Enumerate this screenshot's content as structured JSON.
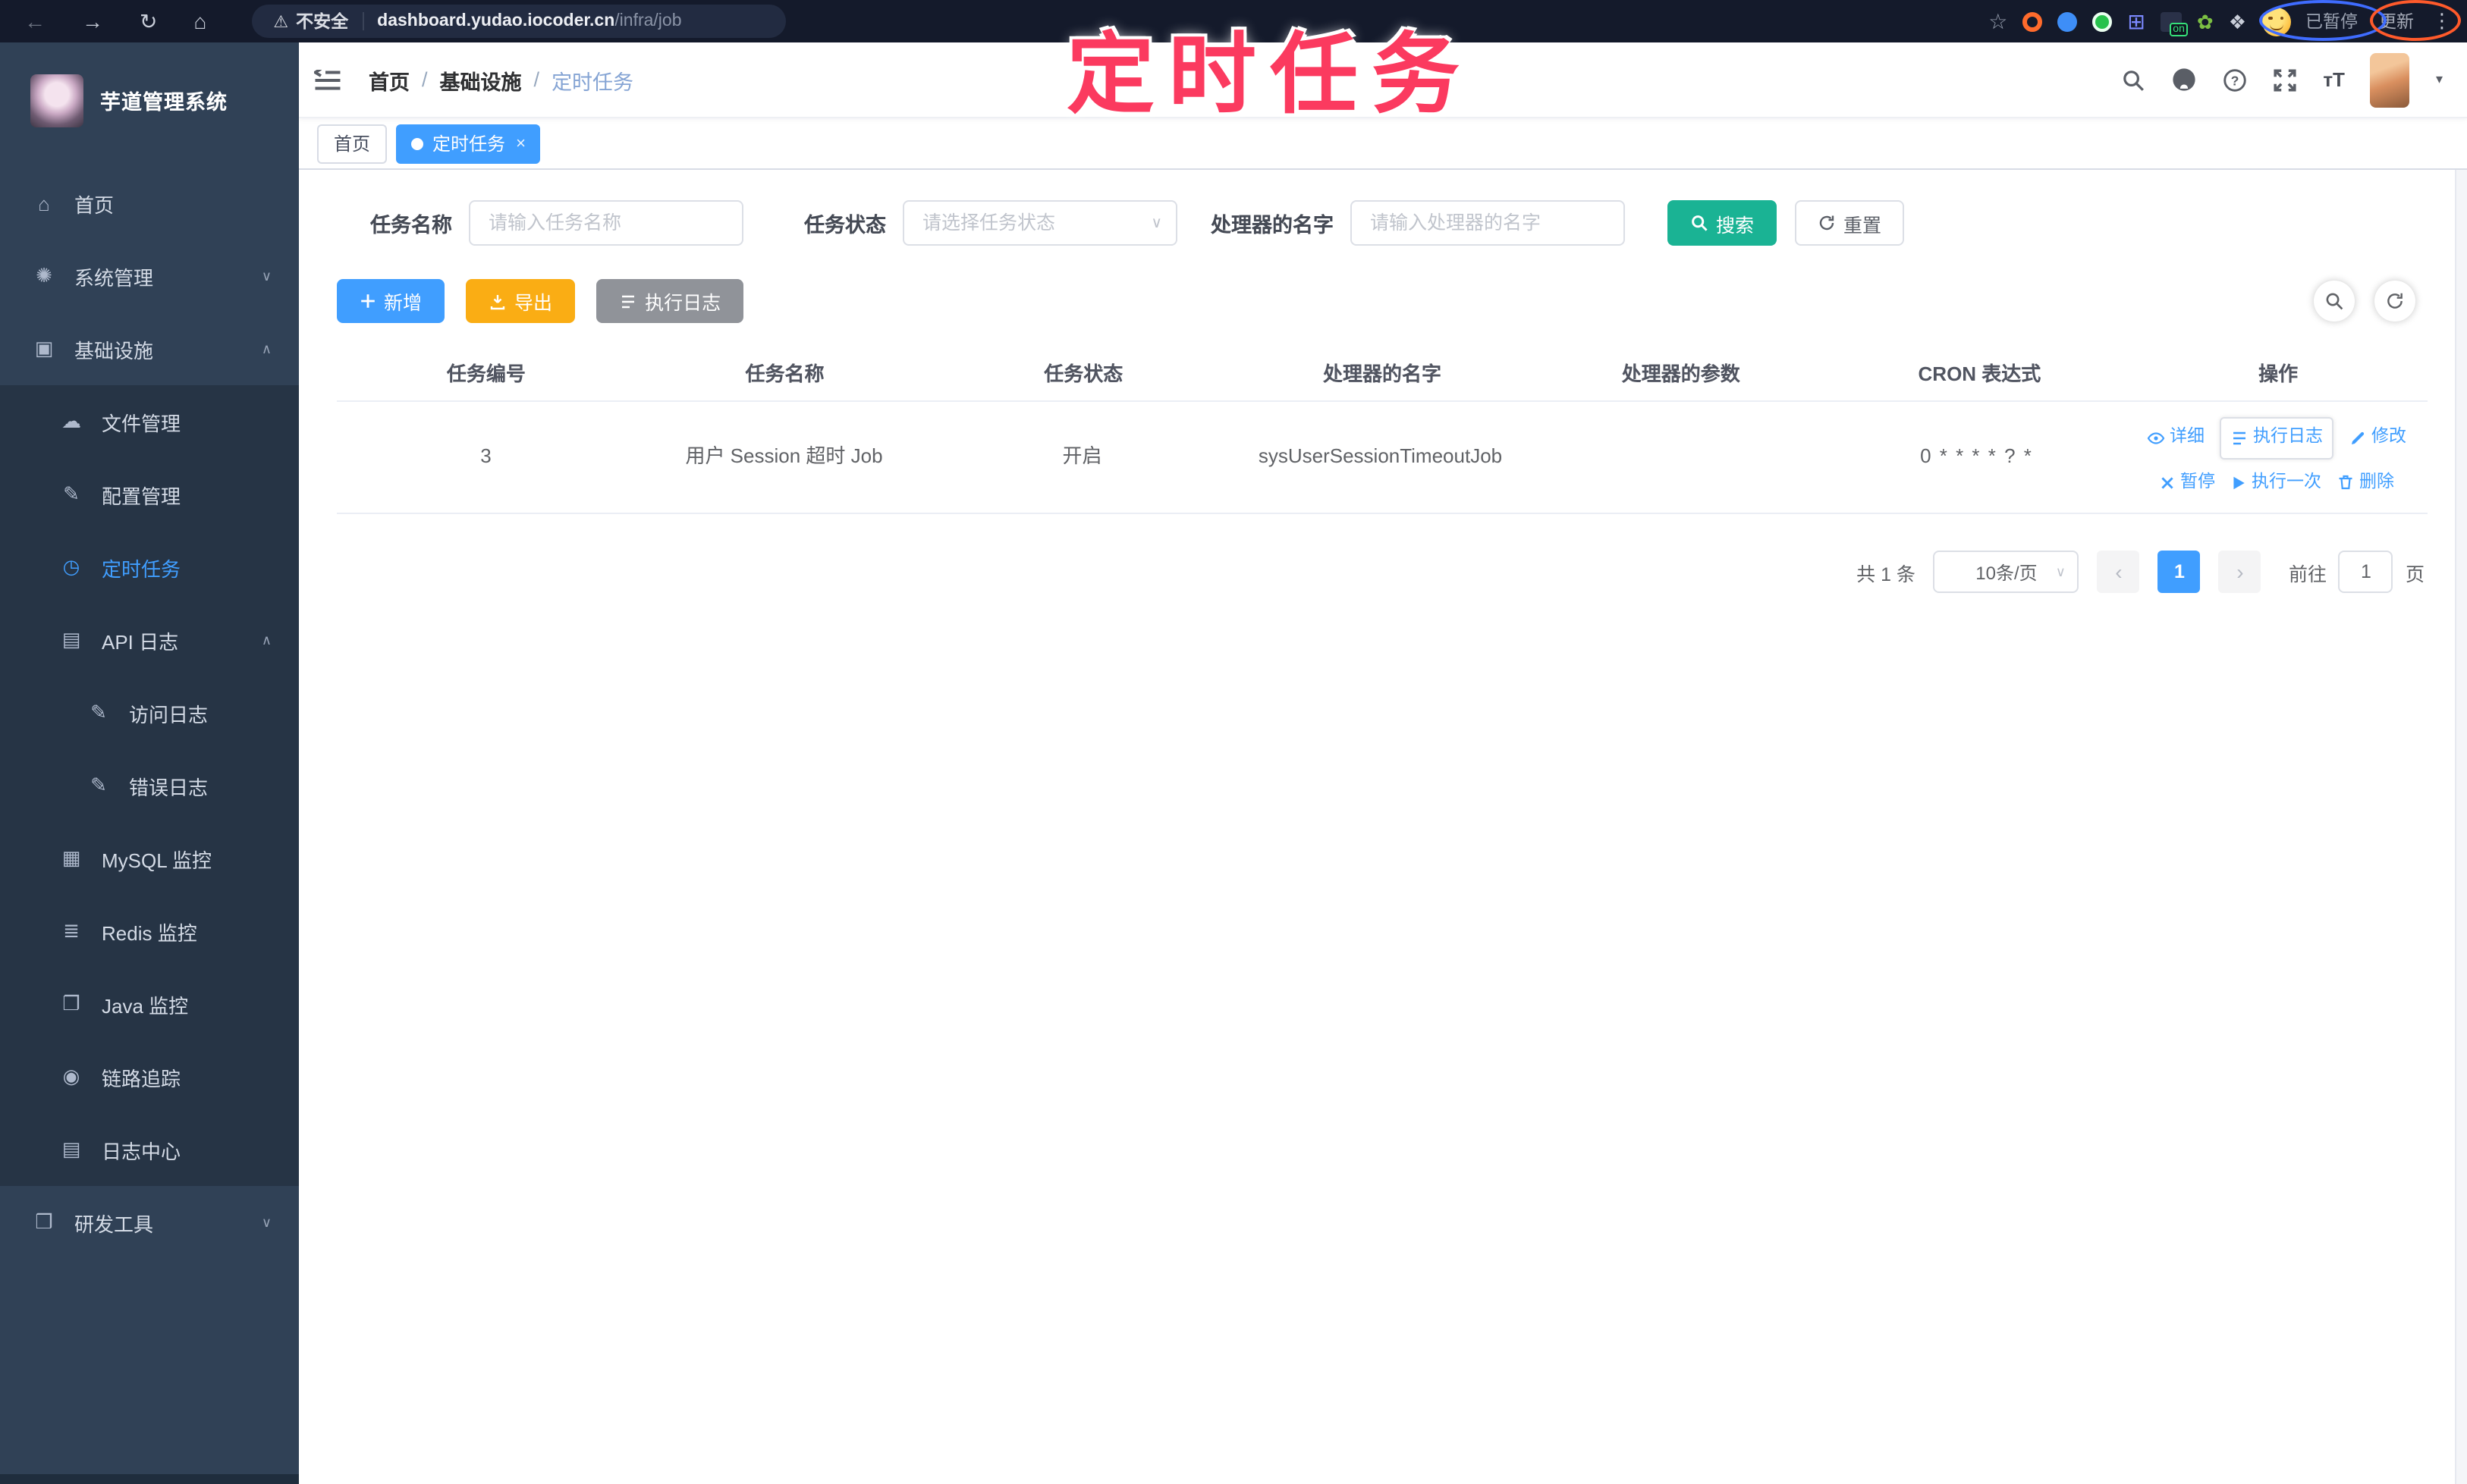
{
  "browser": {
    "back_icon": "←",
    "forward_icon": "→",
    "reload_icon": "↻",
    "home_icon": "⌂",
    "warning_icon": "⚠",
    "security_label": "不安全",
    "url_host": "dashboard.yudao.iocoder.cn",
    "url_path": "/infra/job",
    "star_icon": "☆",
    "grid_icon": "⊞",
    "plant_icon": "✿",
    "puzzle_icon": "❖",
    "extension_on_badge": "on",
    "paused_label": "已暂停",
    "update_label": "更新",
    "menu_icon": "⋮"
  },
  "annotation": {
    "title": "定时任务"
  },
  "sidebar": {
    "logo_title": "芋道管理系统",
    "items": [
      {
        "key": "home",
        "label": "首页",
        "glyph": "⌂",
        "level": 0
      },
      {
        "key": "system-manage",
        "label": "系统管理",
        "glyph": "✺",
        "level": 0,
        "chevron": "∨"
      },
      {
        "key": "infrastructure",
        "label": "基础设施",
        "glyph": "▣",
        "level": 0,
        "chevron": "∧"
      },
      {
        "key": "file-manage",
        "label": "文件管理",
        "glyph": "☁",
        "level": 1,
        "group": true
      },
      {
        "key": "config-manage",
        "label": "配置管理",
        "glyph": "✎",
        "level": 1,
        "group": true
      },
      {
        "key": "job",
        "label": "定时任务",
        "glyph": "◷",
        "level": 1,
        "group": true,
        "active": true
      },
      {
        "key": "api-log",
        "label": "API 日志",
        "glyph": "▤",
        "level": 1,
        "group": true,
        "chevron": "∧"
      },
      {
        "key": "access-log",
        "label": "访问日志",
        "glyph": "✎",
        "level": 2,
        "group": true
      },
      {
        "key": "error-log",
        "label": "错误日志",
        "glyph": "✎",
        "level": 2,
        "group": true
      },
      {
        "key": "mysql-monitor",
        "label": "MySQL 监控",
        "glyph": "▦",
        "level": 1,
        "group": true
      },
      {
        "key": "redis-monitor",
        "label": "Redis 监控",
        "glyph": "≣",
        "level": 1,
        "group": true
      },
      {
        "key": "java-monitor",
        "label": "Java 监控",
        "glyph": "❐",
        "level": 1,
        "group": true
      },
      {
        "key": "trace",
        "label": "链路追踪",
        "glyph": "◉",
        "level": 1,
        "group": true
      },
      {
        "key": "log-center",
        "label": "日志中心",
        "glyph": "▤",
        "level": 1,
        "group": true
      },
      {
        "key": "dev-tools",
        "label": "研发工具",
        "glyph": "❒",
        "level": 0,
        "chevron": "∨"
      }
    ]
  },
  "header": {
    "breadcrumb_1": "首页",
    "breadcrumb_2": "基础设施",
    "breadcrumb_3": "定时任务",
    "separator": "/"
  },
  "tabs": {
    "tab_1": "首页",
    "tab_2": "定时任务",
    "close_icon": "×"
  },
  "filters": {
    "name_label": "任务名称",
    "name_placeholder": "请输入任务名称",
    "status_label": "任务状态",
    "status_placeholder": "请选择任务状态",
    "handler_label": "处理器的名字",
    "handler_placeholder": "请输入处理器的名字",
    "search_label": "搜索",
    "reset_label": "重置"
  },
  "toolbar": {
    "add_label": "新增",
    "export_label": "导出",
    "exec_log_label": "执行日志"
  },
  "table": {
    "headers": [
      "任务编号",
      "任务名称",
      "任务状态",
      "处理器的名字",
      "处理器的参数",
      "CRON 表达式",
      "操作"
    ],
    "row": {
      "id": "3",
      "name": "用户 Session 超时 Job",
      "status": "开启",
      "handler": "sysUserSessionTimeoutJob",
      "param": "",
      "cron": "0 * * * * ? *"
    },
    "actions": [
      {
        "label": "详细"
      },
      {
        "label": "执行日志",
        "focused": true
      },
      {
        "label": "修改"
      },
      {
        "label": "暂停"
      },
      {
        "label": "执行一次"
      },
      {
        "label": "删除"
      }
    ]
  },
  "pagination": {
    "total": "共 1 条",
    "page_size": "10条/页",
    "prev": "‹",
    "page": "1",
    "next": "›",
    "goto_label": "前往",
    "goto_value": "1",
    "page_unit": "页"
  },
  "colors": {
    "primary": "#409eff",
    "search_button": "#1ab394",
    "export_button": "#faad14",
    "info_button": "#909399",
    "sidebar_bg": "#304156",
    "submenu_bg": "#263445",
    "annotation_pink": "#fb3a5f"
  }
}
